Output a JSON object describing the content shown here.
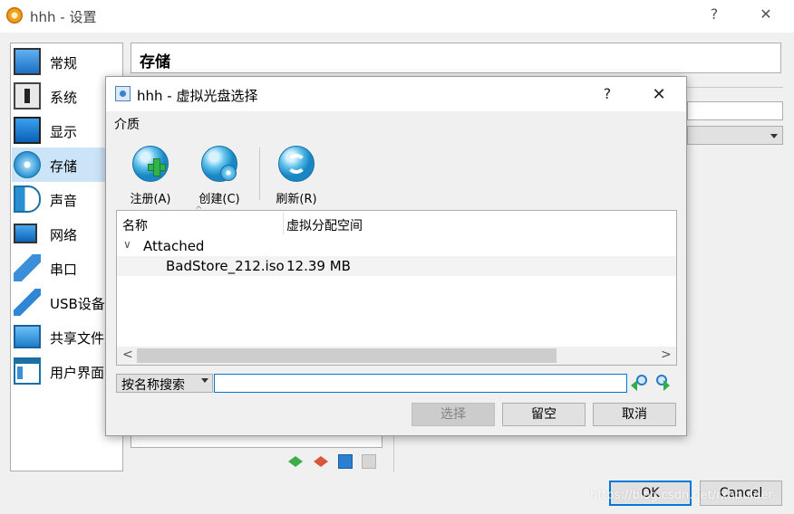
{
  "window": {
    "title": "hhh - 设置",
    "help_glyph": "?",
    "close_glyph": "✕"
  },
  "sidebar": {
    "items": [
      {
        "label": "常规"
      },
      {
        "label": "系统"
      },
      {
        "label": "显示"
      },
      {
        "label": "存储",
        "selected": true
      },
      {
        "label": "声音"
      },
      {
        "label": "网络"
      },
      {
        "label": "串口"
      },
      {
        "label": "USB设备"
      },
      {
        "label": "共享文件夹"
      },
      {
        "label": "用户界面"
      }
    ]
  },
  "section": {
    "title": "存储"
  },
  "buttons": {
    "ok": "OK",
    "cancel": "Cancel"
  },
  "watermark": "https://blog.csdn.net/rxnbulder",
  "dialog": {
    "title": "hhh - 虚拟光盘选择",
    "help_glyph": "?",
    "close_glyph": "✕",
    "menu": {
      "media": "介质"
    },
    "toolbar": {
      "register": "注册(A)",
      "create": "创建(C)",
      "refresh": "刷新(R)"
    },
    "table": {
      "columns": [
        "名称",
        "虚拟分配空间"
      ],
      "sort_glyph": "^",
      "group": {
        "chevron": "∨",
        "label": "Attached"
      },
      "rows": [
        {
          "name": "BadStore_212.iso",
          "size": "12.39 MB"
        }
      ],
      "scroll_left": "<",
      "scroll_right": ">"
    },
    "search": {
      "mode": "按名称搜索",
      "value": "",
      "placeholder": ""
    },
    "buttons": {
      "choose": "选择",
      "leave_empty": "留空",
      "cancel": "取消"
    }
  },
  "colors": {
    "accent": "#0078d7",
    "selection": "#cce4f7",
    "disc_blue": "#1987c5",
    "add_green": "#32b34a"
  }
}
